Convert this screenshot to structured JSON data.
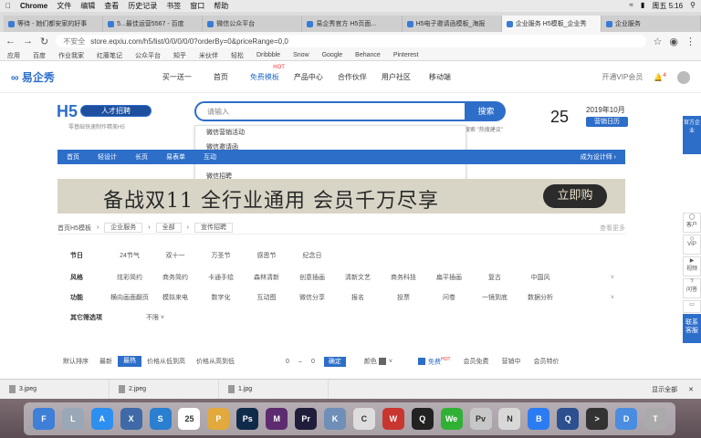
{
  "menubar": {
    "app": "Chrome",
    "items": [
      "文件",
      "编辑",
      "查看",
      "历史记录",
      "书签",
      "窗口",
      "帮助"
    ],
    "clock": "周五 5:16"
  },
  "tabs": [
    {
      "label": "等待 - 她们都安家的好事"
    },
    {
      "label": "5...最佳运营5567 - 百度"
    },
    {
      "label": "微信公众平台"
    },
    {
      "label": "易企秀官方 H5页面..."
    },
    {
      "label": "H5电子邀请函模板_海报"
    },
    {
      "label": "企业服务 H5模板_企业秀",
      "active": true
    },
    {
      "label": "企业服务"
    }
  ],
  "addressbar": {
    "security": "不安全",
    "url": "store.eqxiu.com/h5/list/0/0/0/0/0?orderBy=0&priceRange=0,0"
  },
  "bookmarks": [
    "应用",
    "百度",
    "作业我家",
    "红藤笔记",
    "公众平台",
    "知乎",
    "米伙伴",
    "轻松",
    "Dribbble",
    "Snow",
    "Google",
    "Behance",
    "Pinterest"
  ],
  "header": {
    "logo": "易企秀",
    "nav": [
      "买一送一",
      "首页",
      "免费模板",
      "产品中心",
      "合作伙伴",
      "用户社区",
      "移动端"
    ],
    "hot_label": "HOT",
    "vip": "开通VIP会员",
    "notif_count": "4"
  },
  "search": {
    "h5_logo": "H5",
    "badge": "人才招聘",
    "slogan": "零基础快速制作精美H5",
    "placeholder": "请输入",
    "button": "搜索",
    "hint": "搜索 \"热搜建议\"",
    "suggestions": [
      "微信营销活动",
      "微信邀请函",
      "微信抽奖游戏",
      "微信招聘"
    ]
  },
  "date": {
    "day": "25",
    "month": "2019年10月",
    "btn": "营销日历"
  },
  "catbar": {
    "items": [
      "首页",
      "轻设计",
      "长页",
      "易表单",
      "互动"
    ],
    "right": "成为设计师 ›"
  },
  "banner": {
    "text": "备战双11 全行业通用 会员千万尽享",
    "button": "立即购"
  },
  "breadcrumb": {
    "root": "首页H5模板",
    "sel1": "企业服务",
    "sel2": "全部",
    "sel3": "宣传招聘",
    "right": "查看更多"
  },
  "filters": [
    {
      "label": "节日",
      "options": [
        "24节气",
        "双十一",
        "万圣节",
        "感恩节",
        "纪念日"
      ]
    },
    {
      "label": "风格",
      "options": [
        "炫彩简约",
        "商务简约",
        "卡通手绘",
        "森林清新",
        "创意插画",
        "清新文艺",
        "商务科技",
        "扁平插画",
        "复古",
        "中国风"
      ]
    },
    {
      "label": "功能",
      "options": [
        "横向画面翻页",
        "模拟来电",
        "数字化",
        "互动图",
        "微信分享",
        "报名",
        "投票",
        "问卷",
        "一镜到底",
        "数据分析"
      ]
    },
    {
      "label": "其它筛选项",
      "options": [
        "不限"
      ]
    }
  ],
  "sortbar": {
    "items": [
      "默认排序",
      "最新",
      "最热",
      "价格从低到高",
      "价格从高到低"
    ],
    "range_from": "0",
    "range_to": "0",
    "confirm": "确定",
    "color_label": "颜色",
    "free_label": "免费",
    "free_tag": "HOT",
    "member_free": "会员免费",
    "featured": "营销中",
    "member_discount": "会员特价"
  },
  "rightbar": {
    "top": "官方企业",
    "mid_items": [
      "客户",
      "VIP",
      "视频",
      "问答",
      "优惠券"
    ],
    "service": "联系客服"
  },
  "downloads": {
    "files": [
      "3.jpeg",
      "2.jpeg",
      "1.jpg"
    ],
    "show_all": "显示全部"
  },
  "dock": {
    "apps": [
      {
        "name": "finder",
        "label": "F",
        "color": "#3e7fd8"
      },
      {
        "name": "launchpad",
        "label": "L",
        "color": "#9aa7b6"
      },
      {
        "name": "app-store",
        "label": "A",
        "color": "#2d8ff0"
      },
      {
        "name": "xcode",
        "label": "X",
        "color": "#3f6aa7"
      },
      {
        "name": "safari",
        "label": "S",
        "color": "#2a7fd0"
      },
      {
        "name": "calendar",
        "label": "25",
        "color": "#ffffff"
      },
      {
        "name": "photos",
        "label": "P",
        "color": "#e2a93c"
      },
      {
        "name": "photoshop",
        "label": "Ps",
        "color": "#102a4a"
      },
      {
        "name": "motion",
        "label": "M",
        "color": "#5d2b6f"
      },
      {
        "name": "premiere",
        "label": "Pr",
        "color": "#1f1d3a"
      },
      {
        "name": "keynote",
        "label": "K",
        "color": "#6f8fb8"
      },
      {
        "name": "chrome",
        "label": "C",
        "color": "#dddddd"
      },
      {
        "name": "wps",
        "label": "W",
        "color": "#c8362f"
      },
      {
        "name": "qq",
        "label": "Q",
        "color": "#222222"
      },
      {
        "name": "wechat",
        "label": "We",
        "color": "#31b036"
      },
      {
        "name": "preview",
        "label": "Pv",
        "color": "#c7c7c7"
      },
      {
        "name": "notes",
        "label": "N",
        "color": "#d8d8d8"
      },
      {
        "name": "baidu-netdisk",
        "label": "B",
        "color": "#2b7cf2"
      },
      {
        "name": "quicktime",
        "label": "Q",
        "color": "#2c4f8f"
      },
      {
        "name": "terminal",
        "label": ">",
        "color": "#333333"
      },
      {
        "name": "downloads-folder",
        "label": "D",
        "color": "#4a8de0"
      },
      {
        "name": "trash",
        "label": "T",
        "color": "#aaaaaa"
      }
    ]
  }
}
